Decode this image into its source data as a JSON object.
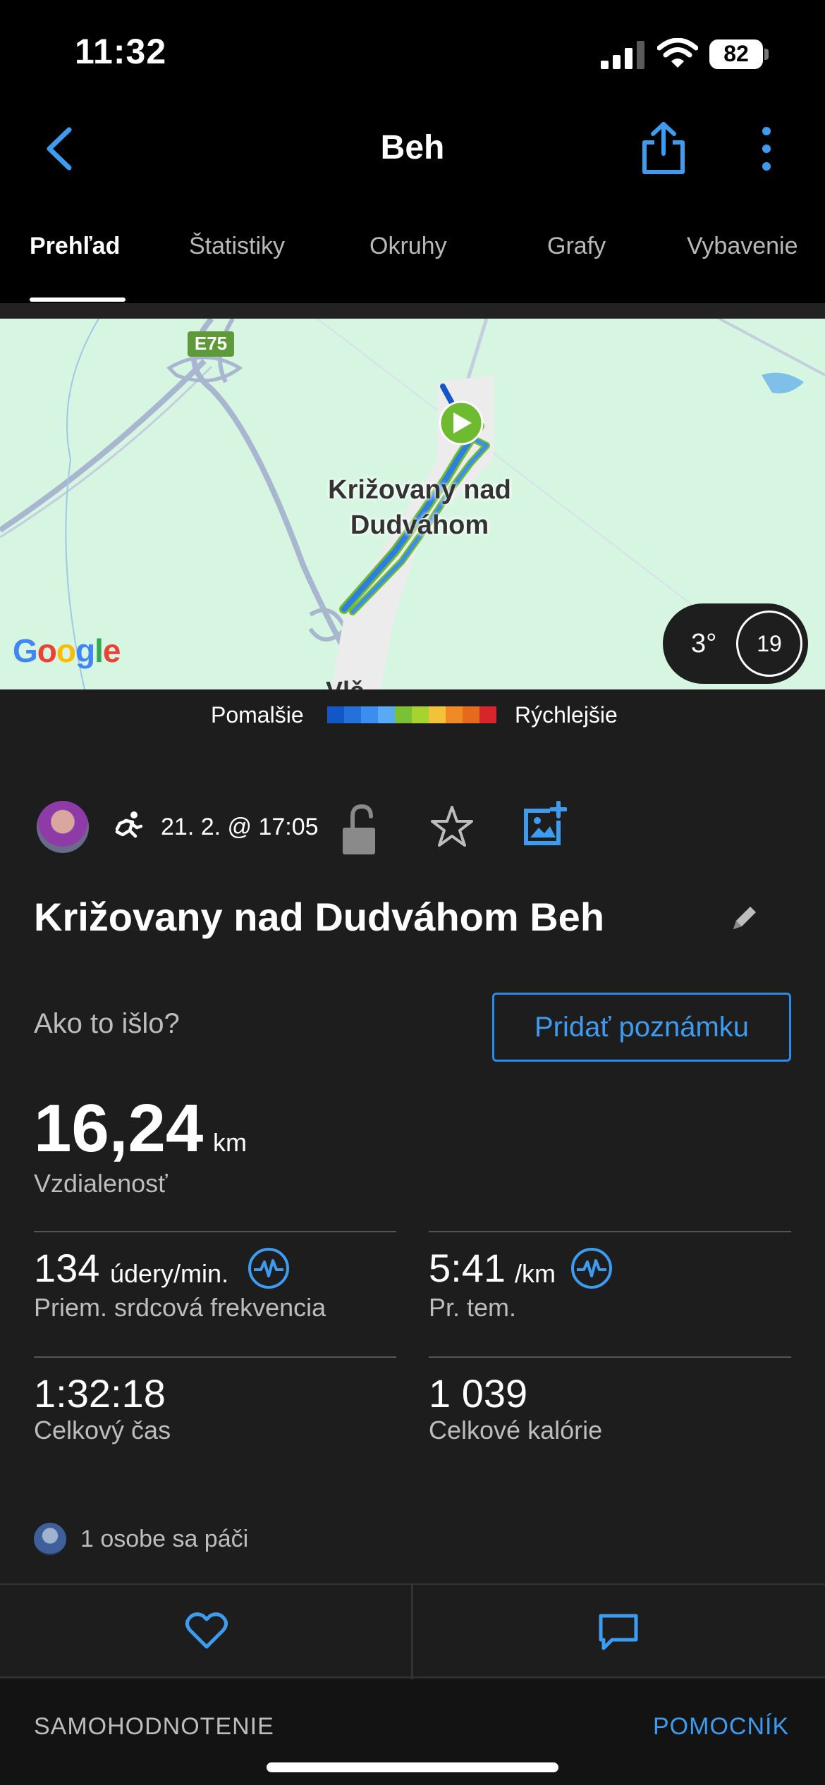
{
  "status_bar": {
    "time": "11:32",
    "battery": "82"
  },
  "header": {
    "title": "Beh"
  },
  "tabs": [
    {
      "label": "Prehľad",
      "active": true
    },
    {
      "label": "Štatistiky",
      "active": false
    },
    {
      "label": "Okruhy",
      "active": false
    },
    {
      "label": "Grafy",
      "active": false
    },
    {
      "label": "Vybavenie",
      "active": false
    }
  ],
  "map": {
    "road_sign": "E75",
    "place_label_line1": "Križovany nad",
    "place_label_line2": "Dudváhom",
    "partial_label": "Vlč",
    "attribution": "Google",
    "weather_temp": "3°",
    "wind_speed": "19"
  },
  "legend": {
    "slower": "Pomalšie",
    "faster": "Rýchlejšie",
    "colors": [
      "#1356c9",
      "#2471dc",
      "#3b8df0",
      "#5aa9f5",
      "#7ac136",
      "#a7d331",
      "#f2c23a",
      "#f08a25",
      "#e56a1c",
      "#d7262b"
    ]
  },
  "activity": {
    "date": "21. 2. @ 17:05",
    "title": "Križovany nad Dudváhom Beh",
    "feeling_prompt": "Ako to išlo?",
    "add_note": "Pridať poznámku",
    "distance": {
      "value": "16,24",
      "unit": "km",
      "label": "Vzdialenosť"
    },
    "stats": [
      {
        "value": "134",
        "unit": "údery/min.",
        "label": "Priem. srdcová frekvencia"
      },
      {
        "value": "5:41",
        "unit": "/km",
        "label": "Pr. tem."
      },
      {
        "value": "1:32:18",
        "unit": "",
        "label": "Celkový čas"
      },
      {
        "value": "1 039",
        "unit": "",
        "label": "Celkové kalórie"
      }
    ],
    "likes": "1 osobe sa páči"
  },
  "footer": {
    "self_evaluation": "SAMOHODNOTENIE",
    "assistant": "POMOCNÍK"
  },
  "colors": {
    "accent": "#3d9cf0",
    "background": "#1d1d1d"
  }
}
